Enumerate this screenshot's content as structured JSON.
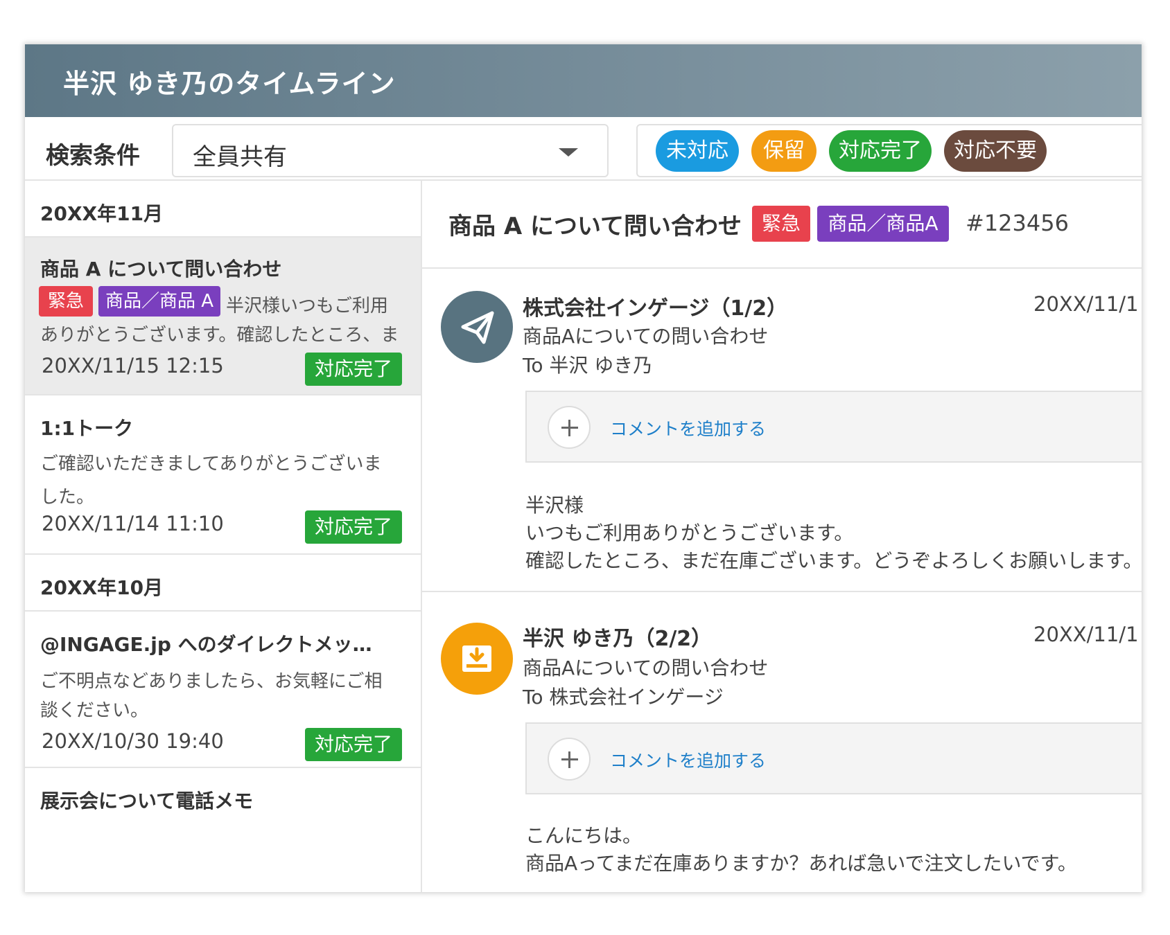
{
  "header": {
    "title": "半沢 ゆき乃のタイムライン"
  },
  "search": {
    "label": "検索条件",
    "selected": "全員共有",
    "statuses": [
      {
        "label": "未対応",
        "color": "#1a9be0"
      },
      {
        "label": "保留",
        "color": "#f39c12"
      },
      {
        "label": "対応完了",
        "color": "#27a63a"
      },
      {
        "label": "対応不要",
        "color": "#6b4b3e"
      }
    ]
  },
  "list": {
    "months": [
      "20XX年11月",
      "20XX年10月"
    ],
    "items": [
      {
        "title": "商品 A について問い合わせ",
        "tags": [
          "緊急",
          "商品／商品 A"
        ],
        "preview_line1": "半沢様いつもご利用",
        "preview_line2": "ありがとうございます。確認したところ、ま",
        "date": "20XX/11/15 12:15",
        "status": "対応完了"
      },
      {
        "title": "1:1トーク",
        "preview_line1": "ご確認いただきましてありがとうございま",
        "preview_line2": "した。",
        "date": "20XX/11/14 11:10",
        "status": "対応完了"
      },
      {
        "title": "@INGAGE.jp へのダイレクトメッ…",
        "preview_line1": "ご不明点などありましたら、お気軽にご相",
        "preview_line2": "談ください。",
        "date": "20XX/10/30 19:40",
        "status": "対応完了"
      },
      {
        "title": "展示会について電話メモ"
      }
    ]
  },
  "detail": {
    "title": "商品 A について問い合わせ",
    "tags": [
      "緊急",
      "商品／商品A"
    ],
    "ticket_id": "#123456",
    "comment_label": "コメントを追加する",
    "messages": [
      {
        "sender": "株式会社インゲージ（1/2）",
        "date": "20XX/11/1",
        "subject": "商品Aについての問い合わせ",
        "to": "To 半沢 ゆき乃",
        "avatar_color": "#587380",
        "icon": "paper-plane-icon",
        "body": [
          "半沢様",
          "いつもご利用ありがとうございます。",
          "確認したところ、まだ在庫ございます。どうぞよろしくお願いします。"
        ]
      },
      {
        "sender": "半沢 ゆき乃（2/2）",
        "date": "20XX/11/1",
        "subject": "商品Aについての問い合わせ",
        "to": "To 株式会社インゲージ",
        "avatar_color": "#f5a00a",
        "icon": "inbox-download-icon",
        "body": [
          "こんにちは。",
          "商品Aってまだ在庫ありますか？あれば急いで注文したいです。"
        ]
      }
    ]
  }
}
